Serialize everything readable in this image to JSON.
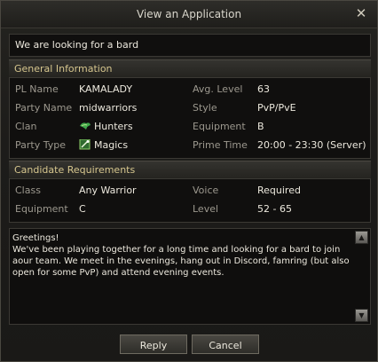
{
  "window": {
    "title": "View an Application"
  },
  "subject": "We are looking for a bard",
  "general": {
    "header": "General Information",
    "rows": [
      {
        "label1": "PL Name",
        "value1": "KAMALADY",
        "label2": "Avg. Level",
        "value2": "63"
      },
      {
        "label1": "Party Name",
        "value1": "midwarriors",
        "label2": "Style",
        "value2": "PvP/PvE"
      },
      {
        "label1": "Clan",
        "value1": "Hunters",
        "label2": "Equipment",
        "value2": "B"
      },
      {
        "label1": "Party Type",
        "value1": "Magics",
        "label2": "Prime Time",
        "value2": "20:00 - 23:30 (Server)"
      }
    ]
  },
  "requirements": {
    "header": "Candidate Requirements",
    "rows": [
      {
        "label1": "Class",
        "value1": "Any Warrior",
        "label2": "Voice",
        "value2": "Required"
      },
      {
        "label1": "Equipment",
        "value1": "C",
        "label2": "Level",
        "value2": "52 - 65"
      }
    ]
  },
  "message": "Greetings!\nWe've been playing together for a long time and looking for a bard to join aour team. We meet in the evenings, hang out in Discord, famring (but also open for some PvP) and attend evening events.",
  "buttons": {
    "reply": "Reply",
    "cancel": "Cancel"
  },
  "icons": {
    "close": "close-icon",
    "clan": "clan-emblem-icon",
    "party_type": "party-type-icon",
    "scroll_up": "scroll-up-icon",
    "scroll_down": "scroll-down-icon"
  },
  "colors": {
    "section_header_text": "#d6c68e",
    "label": "#9c988e",
    "value": "#ece8dd"
  }
}
